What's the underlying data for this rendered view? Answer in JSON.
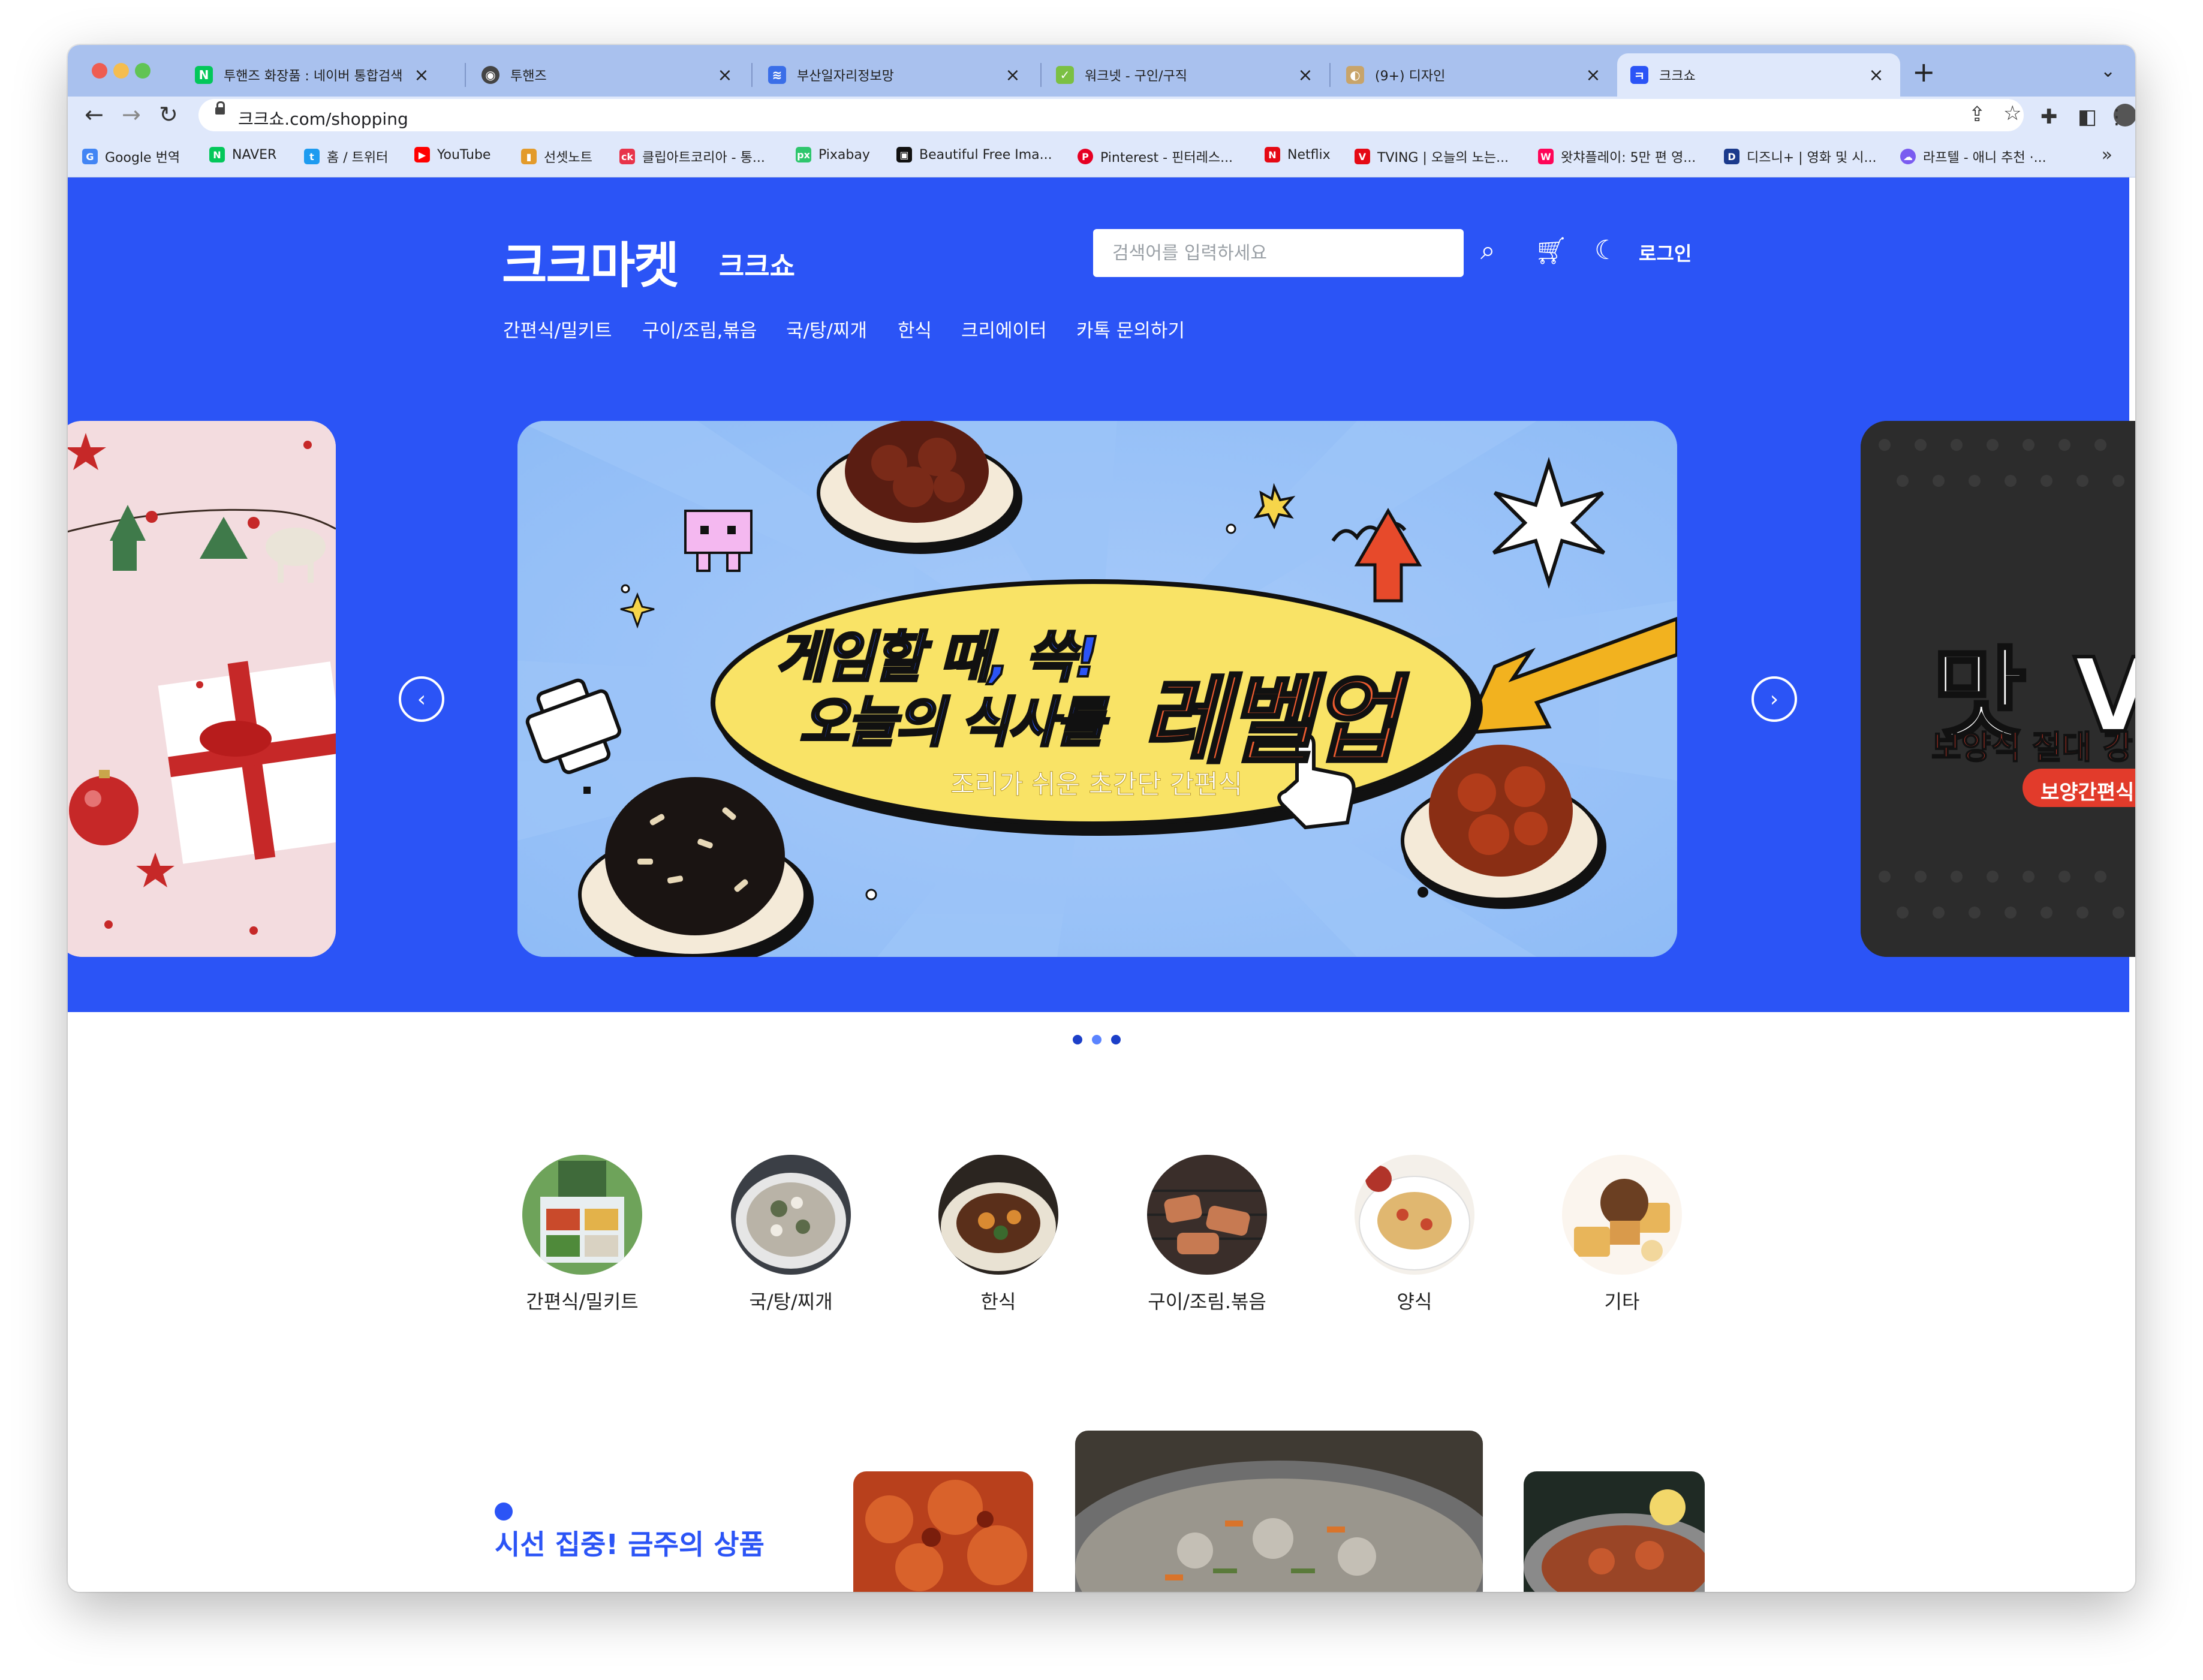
{
  "browser": {
    "tabs": [
      {
        "title": "투핸즈 화장품 : 네이버 통합검색",
        "favicon": "naver-icon",
        "color": "#03c75a",
        "glyph": "N"
      },
      {
        "title": "투핸즈",
        "favicon": "globe-icon",
        "color": "#444444",
        "glyph": "◉"
      },
      {
        "title": "부산일자리정보망",
        "favicon": "busan-job-icon",
        "color": "#3a6ee8",
        "glyph": "≋"
      },
      {
        "title": "워크넷 - 구인/구직",
        "favicon": "worknet-icon",
        "color": "#7bc043",
        "glyph": "✓"
      },
      {
        "title": "(9+) 디자인",
        "favicon": "palette-icon",
        "color": "#c8a46a",
        "glyph": "◐"
      },
      {
        "title": "크크쇼",
        "favicon": "kkshow-icon",
        "color": "#2b54f6",
        "glyph": "ㅋ"
      }
    ],
    "url": "크크쇼.com/shopping",
    "bookmarks": [
      {
        "label": "Google 번역",
        "color": "#4285f4",
        "glyph": "G"
      },
      {
        "label": "NAVER",
        "color": "#03c75a",
        "glyph": "N"
      },
      {
        "label": "홈 / 트위터",
        "color": "#1d9bf0",
        "glyph": "t"
      },
      {
        "label": "YouTube",
        "color": "#ff0000",
        "glyph": "▶"
      },
      {
        "label": "선셋노트",
        "color": "#e39b2b",
        "glyph": "▮"
      },
      {
        "label": "클립아트코리아 - 통...",
        "color": "#e8334a",
        "glyph": "ck"
      },
      {
        "label": "Pixabay",
        "color": "#2ec66d",
        "glyph": "px"
      },
      {
        "label": "Beautiful Free Ima...",
        "color": "#111111",
        "glyph": "▣"
      },
      {
        "label": "Pinterest - 핀터레스...",
        "color": "#e60023",
        "glyph": "P"
      },
      {
        "label": "Netflix",
        "color": "#e50914",
        "glyph": "N"
      },
      {
        "label": "TVING | 오늘의 노는...",
        "color": "#e50914",
        "glyph": "V"
      },
      {
        "label": "왓챠플레이: 5만 편 영...",
        "color": "#ff0558",
        "glyph": "W"
      },
      {
        "label": "디즈니+ | 영화 및 시...",
        "color": "#1b3a8c",
        "glyph": "D"
      },
      {
        "label": "라프텔 - 애니 추천 ·...",
        "color": "#7a5cf0",
        "glyph": "☁"
      }
    ],
    "bookmarks_more": "»"
  },
  "site": {
    "logo": "크크마켓",
    "logo_sub": "크크쇼",
    "search_placeholder": "검색어를 입력하세요",
    "login": "로그인",
    "menu": [
      "간편식/밀키트",
      "구이/조림,볶음",
      "국/탕/찌개",
      "한식",
      "크리에이터",
      "카톡 문의하기"
    ]
  },
  "banner": {
    "line1": "게임할 때, 쓱!",
    "line2": "오늘의 식사를",
    "highlight": "레벨업",
    "subtitle": "조리가 쉬운 초간단 간편식",
    "right_title": "맛 V",
    "right_sub": "보양식 절대 강",
    "right_badge": "보양간편식",
    "prev_icon": "chevron-left-icon",
    "next_icon": "chevron-right-icon",
    "dots": 3,
    "active_dot": 2
  },
  "categories": [
    {
      "label": "간편식/밀키트",
      "image": "meal-kit-box"
    },
    {
      "label": "국/탕/찌개",
      "image": "soup-bowl"
    },
    {
      "label": "한식",
      "image": "braised-dish"
    },
    {
      "label": "구이/조림.볶음",
      "image": "grilled-meat"
    },
    {
      "label": "양식",
      "image": "pasta-plate"
    },
    {
      "label": "기타",
      "image": "dessert-platter"
    }
  ],
  "featured": {
    "title": "시선 집중! 금주의 상품"
  },
  "colors": {
    "brand": "#2b54f6",
    "tabstrip": "#a9c1ee",
    "toolbar": "#dfe8fb"
  }
}
